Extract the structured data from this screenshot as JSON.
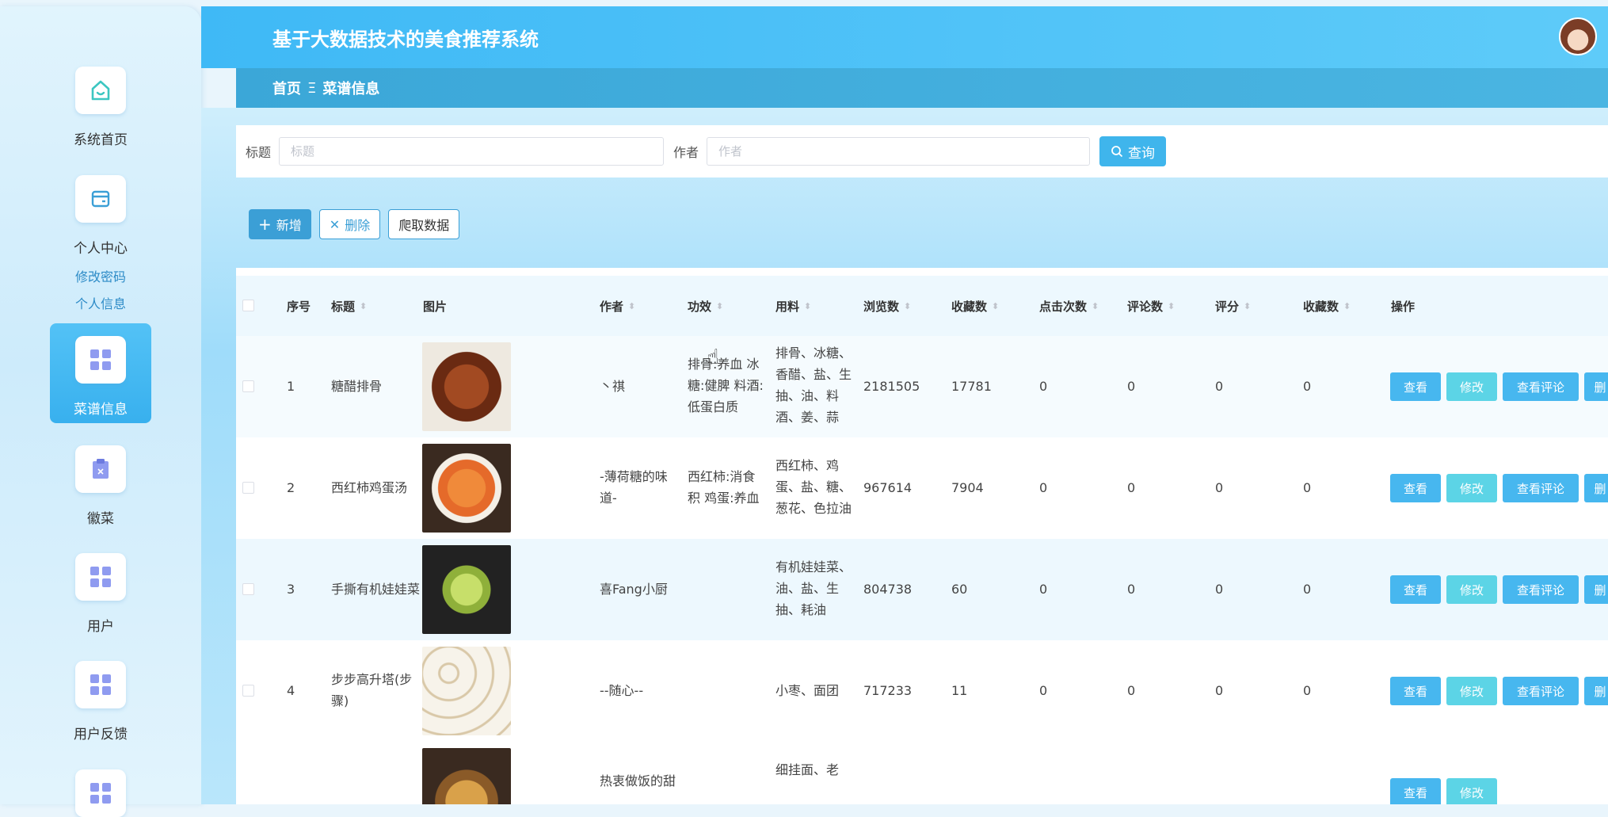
{
  "header": {
    "title": "基于大数据技术的美食推荐系统"
  },
  "breadcrumb": {
    "home": "首页",
    "separator": "Ξ",
    "current": "菜谱信息"
  },
  "sidebar": {
    "items": [
      {
        "label": "系统首页",
        "icon": "home-icon"
      },
      {
        "label": "个人中心",
        "icon": "wallet-icon"
      },
      {
        "label": "菜谱信息",
        "icon": "grid-icon",
        "active": true
      },
      {
        "label": "徽菜",
        "icon": "clipboard-icon"
      },
      {
        "label": "用户",
        "icon": "grid-icon"
      },
      {
        "label": "用户反馈",
        "icon": "grid-icon"
      }
    ],
    "sub_items": [
      "修改密码",
      "个人信息"
    ]
  },
  "search": {
    "title_label": "标题",
    "title_placeholder": "标题",
    "author_label": "作者",
    "author_placeholder": "作者",
    "button": "查询"
  },
  "toolbar": {
    "add": "新增",
    "delete": "删除",
    "crawl": "爬取数据"
  },
  "table": {
    "columns": [
      "序号",
      "标题",
      "图片",
      "作者",
      "功效",
      "用料",
      "浏览数",
      "收藏数",
      "点击次数",
      "评论数",
      "评分",
      "收藏数",
      "操作"
    ],
    "actions": {
      "view": "查看",
      "edit": "修改",
      "comments": "查看评论",
      "delete": "删"
    },
    "rows": [
      {
        "no": "1",
        "title": "糖醋排骨",
        "author": "丶祺",
        "effect": "排骨:养血 冰糖:健脾 料酒:低蛋白质",
        "ingredients": "排骨、冰糖、香醋、盐、生抽、油、料酒、姜、蒜",
        "views": "2181505",
        "favorites": "17781",
        "clicks": "0",
        "comments": "0",
        "rating": "0",
        "collects": "0",
        "color": "#8a3a1c"
      },
      {
        "no": "2",
        "title": "西红柿鸡蛋汤",
        "author": "-薄荷糖的味道-",
        "effect": "西红柿:消食积 鸡蛋:养血",
        "ingredients": "西红柿、鸡蛋、盐、糖、葱花、色拉油",
        "views": "967614",
        "favorites": "7904",
        "clicks": "0",
        "comments": "0",
        "rating": "0",
        "collects": "0",
        "color": "#e8743a"
      },
      {
        "no": "3",
        "title": "手撕有机娃娃菜",
        "author": "喜Fang小厨",
        "effect": "",
        "ingredients": "有机娃娃菜、油、盐、生抽、耗油",
        "views": "804738",
        "favorites": "60",
        "clicks": "0",
        "comments": "0",
        "rating": "0",
        "collects": "0",
        "color": "#9cc24a"
      },
      {
        "no": "4",
        "title": "步步高升塔(步骤)",
        "author": "--随心--",
        "effect": "",
        "ingredients": "小枣、面团",
        "views": "717233",
        "favorites": "11",
        "clicks": "0",
        "comments": "0",
        "rating": "0",
        "collects": "0",
        "color": "#e9e2d2"
      },
      {
        "no": "",
        "title": "",
        "author": "热衷做饭的甜",
        "effect": "",
        "ingredients": "细挂面、老",
        "views": "",
        "favorites": "",
        "clicks": "",
        "comments": "",
        "rating": "",
        "collects": "",
        "color": "#c9883c"
      }
    ]
  }
}
